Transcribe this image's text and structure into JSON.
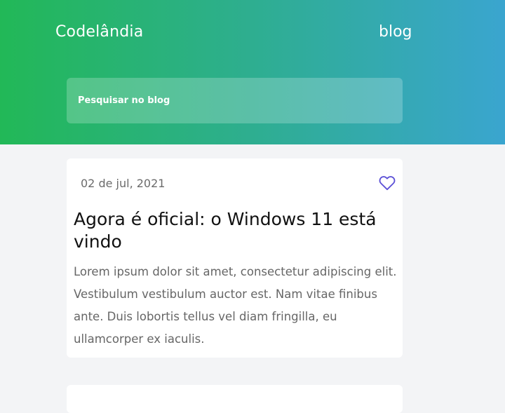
{
  "header": {
    "brand": "Codelândia",
    "nav_blog": "blog",
    "search_placeholder": "Pesquisar no blog",
    "gradient_colors": [
      "#22b857",
      "#3aa5cf"
    ]
  },
  "posts": [
    {
      "date": "02 de jul, 2021",
      "title": "Agora é oficial: o Windows 11 está vindo",
      "excerpt": "Lorem ipsum dolor sit amet, consectetur adipiscing elit. Vestibulum vestibulum auctor est. Nam vitae finibus ante. Duis lobortis tellus vel diam fringilla, eu ullamcorper ex iaculis.",
      "favorite_icon": "heart-icon",
      "favorite_color": "#5b4fd6"
    }
  ]
}
